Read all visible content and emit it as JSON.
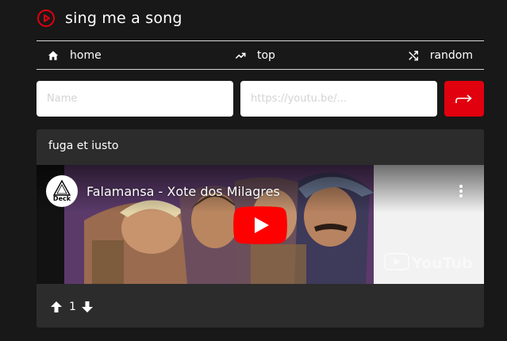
{
  "app": {
    "title": "sing me a song",
    "logo_icon": "play-circle-icon",
    "accent_color": "#e0000e"
  },
  "nav": {
    "items": [
      {
        "label": "home",
        "icon": "home-icon"
      },
      {
        "label": "top",
        "icon": "trending-up-icon"
      },
      {
        "label": "random",
        "icon": "shuffle-icon"
      }
    ]
  },
  "form": {
    "name_placeholder": "Name",
    "link_placeholder": "https://youtu.be/...",
    "submit_icon": "arrow-right-icon"
  },
  "recommendations": [
    {
      "name": "fuga et iusto",
      "video": {
        "title": "Falamansa - Xote dos Milagres",
        "channel_badge": "Deck",
        "watermark": "YouTube"
      },
      "score": "1"
    }
  ]
}
